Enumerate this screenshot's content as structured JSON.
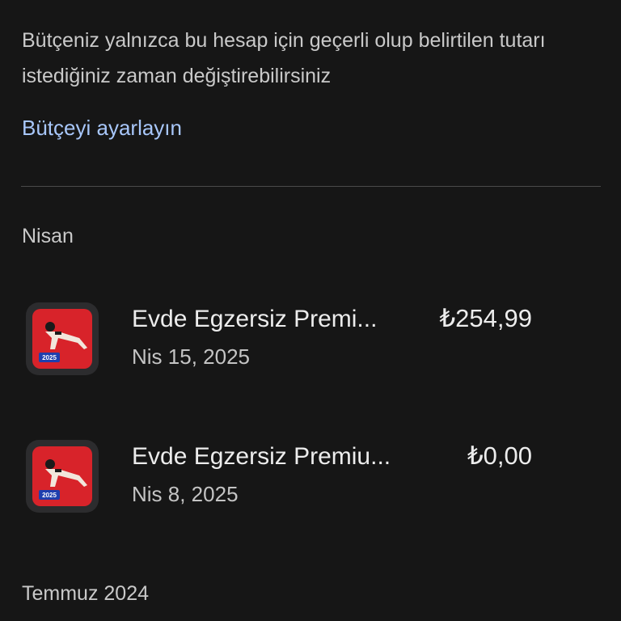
{
  "budget": {
    "description": "Bütçeniz yalnızca bu hesap için geçerli olup belirtilen tutarı istediğiniz zaman değiştirebilirsiniz",
    "link_label": "Bütçeyi ayarlayın"
  },
  "sections": [
    {
      "title": "Nisan",
      "items": [
        {
          "app_name": "Evde Egzersiz Premi...",
          "date": "Nis 15, 2025",
          "price": "₺254,99",
          "icon": "workout-app-icon",
          "icon_badge": "2025"
        },
        {
          "app_name": "Evde Egzersiz Premiu...",
          "date": "Nis 8, 2025",
          "price": "₺0,00",
          "icon": "workout-app-icon",
          "icon_badge": "2025"
        }
      ]
    },
    {
      "title": "Temmuz 2024",
      "items": []
    }
  ],
  "colors": {
    "background": "#161616",
    "link": "#a8c7fa",
    "icon_red": "#d8232a",
    "icon_badge_blue": "#1e3fae"
  }
}
